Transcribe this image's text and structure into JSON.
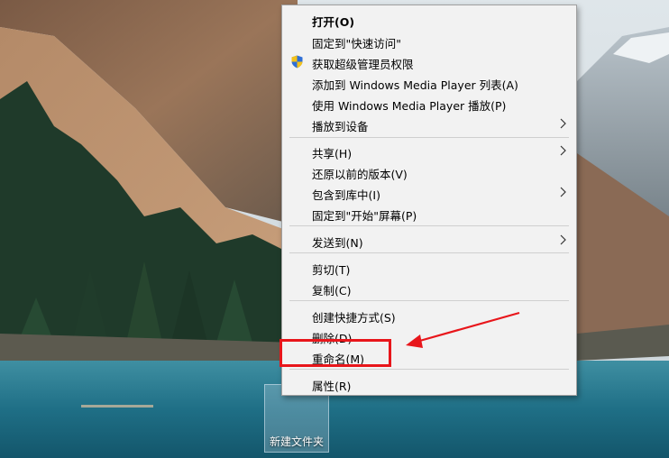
{
  "desktop": {
    "folder_label": "新建文件夹"
  },
  "context_menu": {
    "items": [
      {
        "label": "打开(O)",
        "bold": true
      },
      {
        "label": "固定到\"快速访问\""
      },
      {
        "label": "获取超级管理员权限",
        "icon": "uac-shield-icon"
      },
      {
        "label": "添加到 Windows Media Player 列表(A)"
      },
      {
        "label": "使用 Windows Media Player 播放(P)"
      },
      {
        "label": "播放到设备",
        "submenu": true
      },
      {
        "label": "共享(H)",
        "submenu": true
      },
      {
        "label": "还原以前的版本(V)"
      },
      {
        "label": "包含到库中(I)",
        "submenu": true
      },
      {
        "label": "固定到\"开始\"屏幕(P)"
      },
      {
        "label": "发送到(N)",
        "submenu": true
      },
      {
        "label": "剪切(T)"
      },
      {
        "label": "复制(C)"
      },
      {
        "label": "创建快捷方式(S)"
      },
      {
        "label": "删除(D)"
      },
      {
        "label": "重命名(M)"
      },
      {
        "label": "属性(R)"
      }
    ]
  },
  "annotation": {
    "highlight_color": "#e8161b",
    "highlighted_item": "重命名(M)"
  }
}
